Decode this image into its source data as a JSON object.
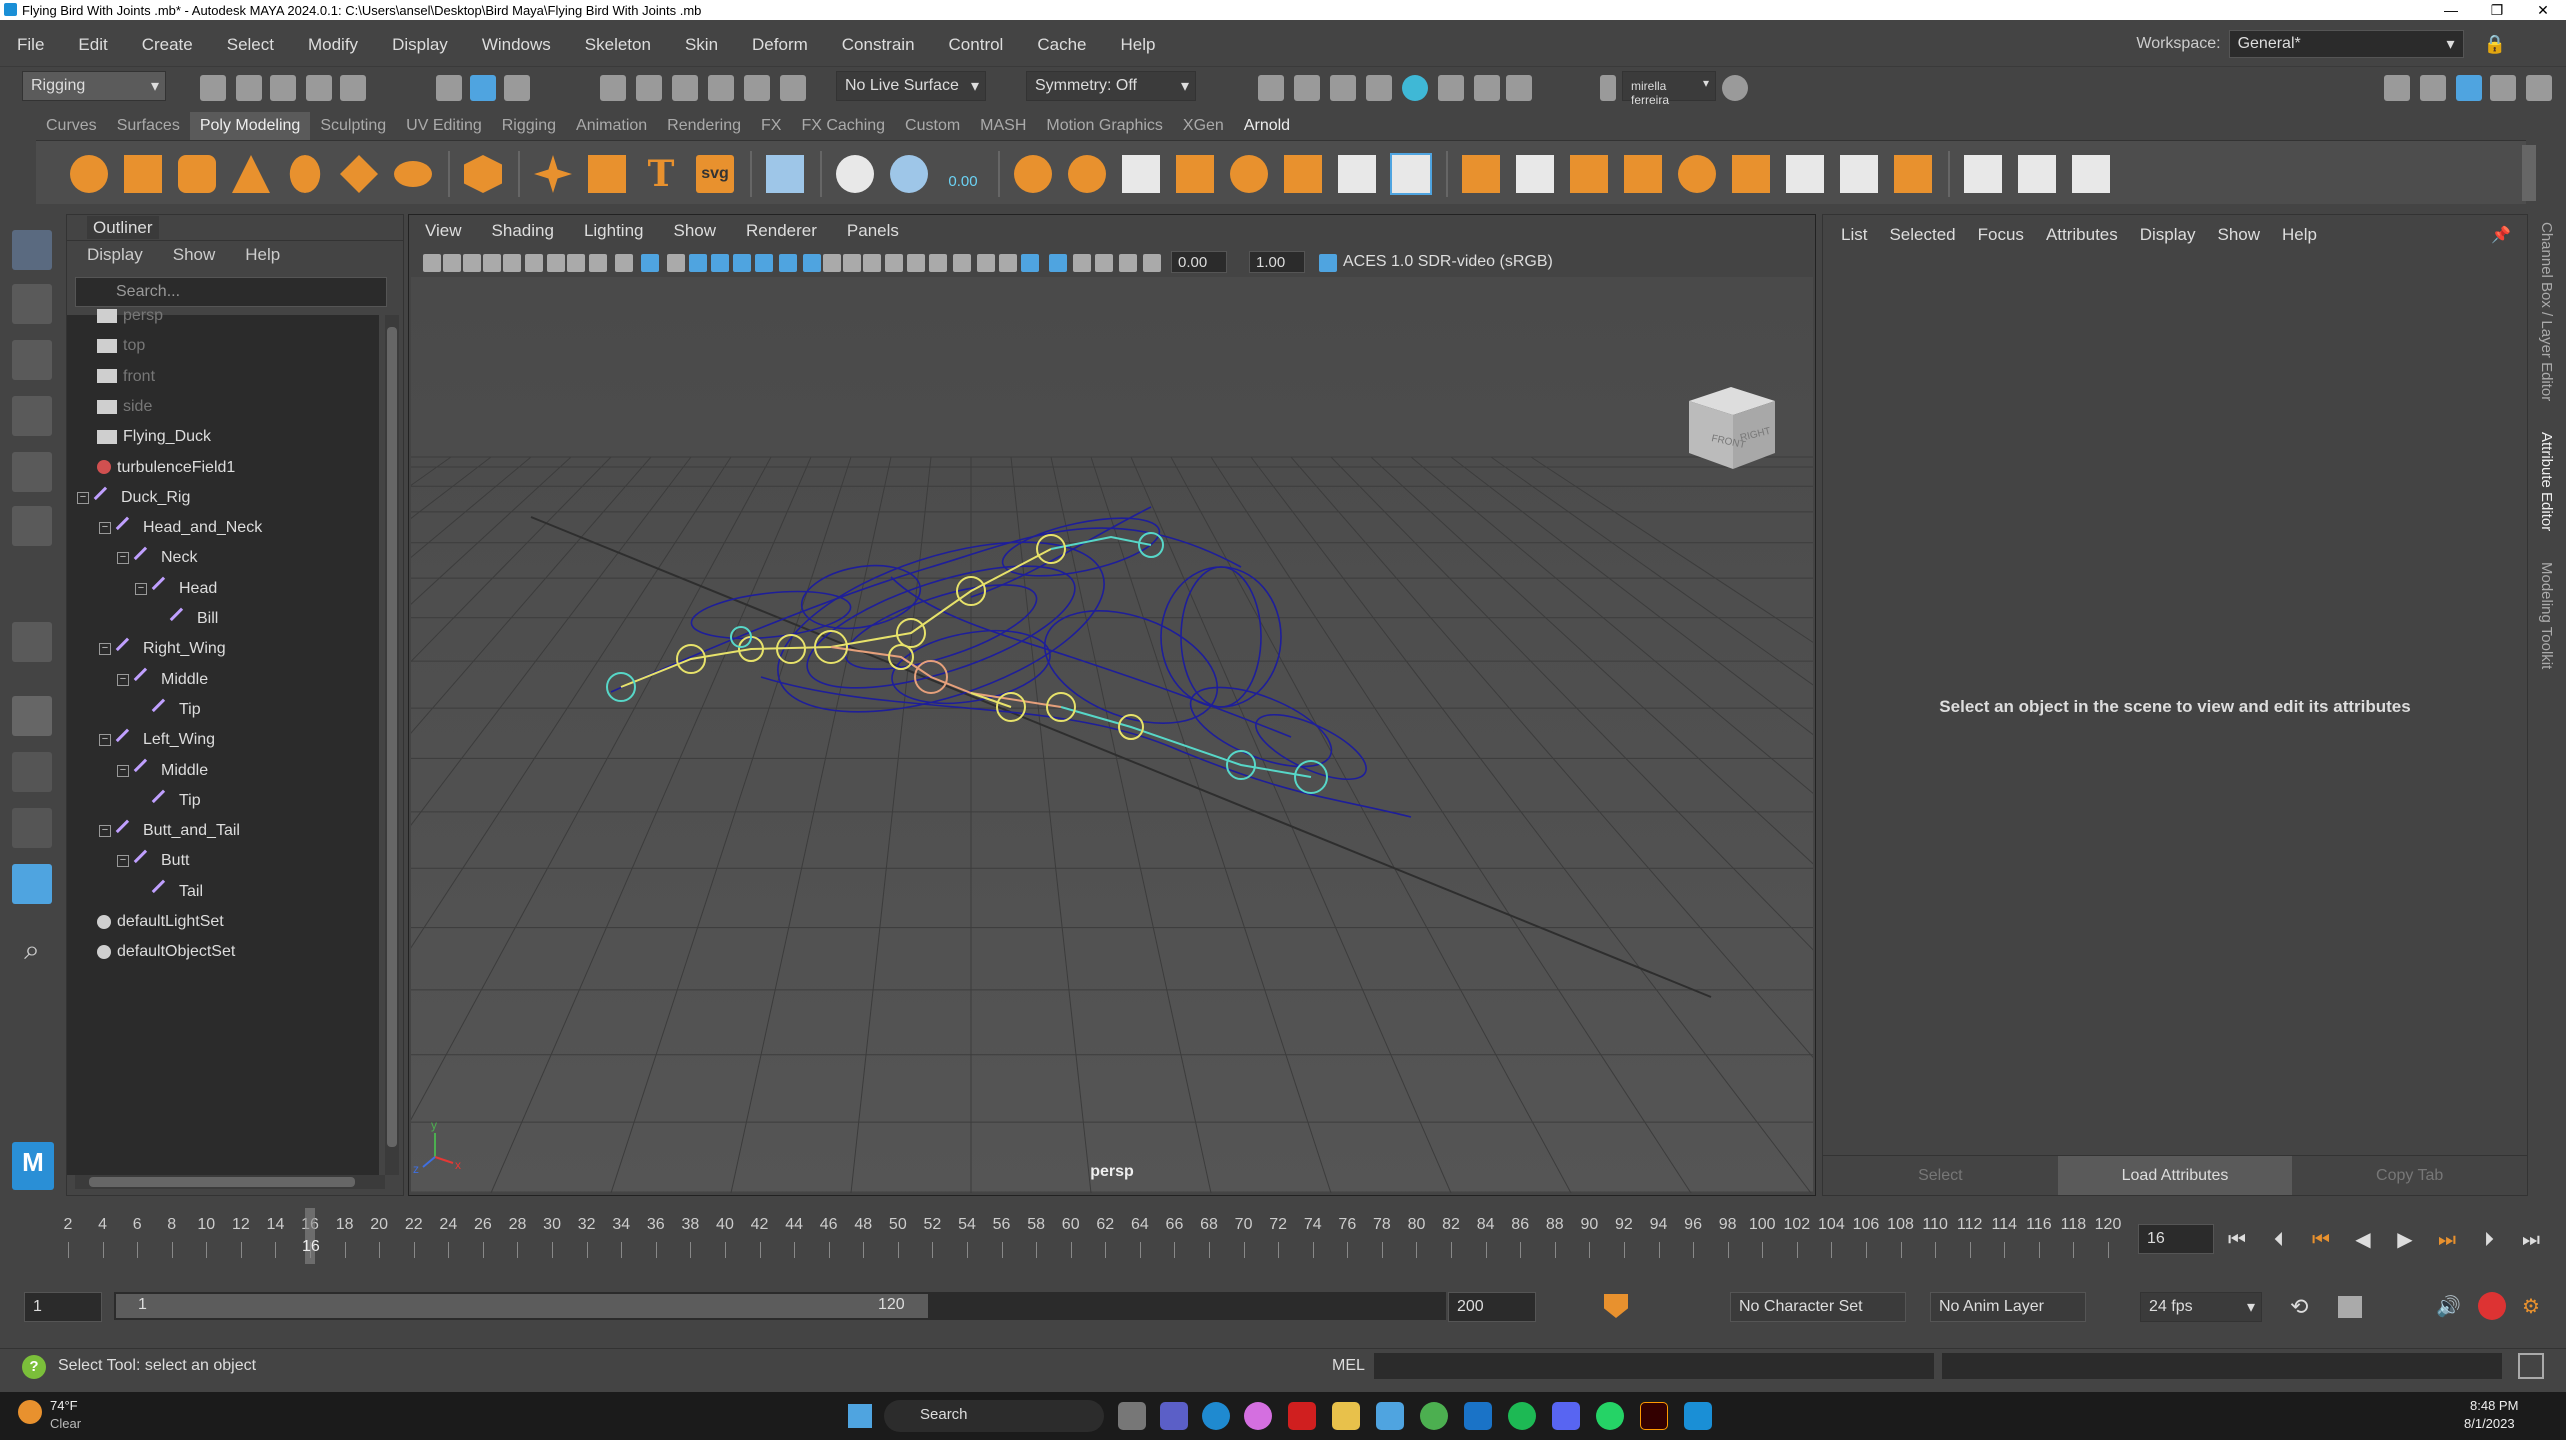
{
  "window": {
    "title": "Flying Bird With Joints .mb* - Autodesk MAYA 2024.0.1: C:\\Users\\ansel\\Desktop\\Bird Maya\\Flying Bird With Joints .mb",
    "controls": [
      "—",
      "❐",
      "✕"
    ]
  },
  "menubar": {
    "items": [
      "File",
      "Edit",
      "Create",
      "Select",
      "Modify",
      "Display",
      "Windows",
      "Skeleton",
      "Skin",
      "Deform",
      "Constrain",
      "Control",
      "Cache",
      "Help"
    ],
    "workspace_label": "Workspace:",
    "workspace_value": "General*"
  },
  "statusline": {
    "menuset": "Rigging",
    "live_surface": "No Live Surface",
    "symmetry": "Symmetry: Off",
    "user": "mirella ferreira"
  },
  "shelf": {
    "tabs": [
      "Curves",
      "Surfaces",
      "Poly Modeling",
      "Sculpting",
      "UV Editing",
      "Rigging",
      "Animation",
      "Rendering",
      "FX",
      "FX Caching",
      "Custom",
      "MASH",
      "Motion Graphics",
      "XGen",
      "Arnold"
    ],
    "active_tab": "Poly Modeling",
    "text_icon_label": "svg",
    "value_label": "0.00"
  },
  "outliner": {
    "title": "Outliner",
    "menu": [
      "Display",
      "Show",
      "Help"
    ],
    "search_placeholder": "Search...",
    "items": [
      {
        "label": "persp",
        "depth": 0,
        "kind": "camera",
        "dim": true
      },
      {
        "label": "top",
        "depth": 0,
        "kind": "camera",
        "dim": true
      },
      {
        "label": "front",
        "depth": 0,
        "kind": "camera",
        "dim": true
      },
      {
        "label": "side",
        "depth": 0,
        "kind": "camera",
        "dim": true
      },
      {
        "label": "Flying_Duck",
        "depth": 0,
        "kind": "mesh",
        "dim": false
      },
      {
        "label": "turbulenceField1",
        "depth": 0,
        "kind": "field",
        "dim": false
      },
      {
        "label": "Duck_Rig",
        "depth": 0,
        "kind": "joint",
        "dim": false,
        "expand": true
      },
      {
        "label": "Head_and_Neck",
        "depth": 1,
        "kind": "joint",
        "dim": false,
        "expand": true
      },
      {
        "label": "Neck",
        "depth": 2,
        "kind": "joint",
        "dim": false,
        "expand": true
      },
      {
        "label": "Head",
        "depth": 3,
        "kind": "joint",
        "dim": false,
        "expand": true
      },
      {
        "label": "Bill",
        "depth": 4,
        "kind": "joint",
        "dim": false
      },
      {
        "label": "Right_Wing",
        "depth": 1,
        "kind": "joint",
        "dim": false,
        "expand": true
      },
      {
        "label": "Middle",
        "depth": 2,
        "kind": "joint",
        "dim": false,
        "expand": true
      },
      {
        "label": "Tip",
        "depth": 3,
        "kind": "joint",
        "dim": false
      },
      {
        "label": "Left_Wing",
        "depth": 1,
        "kind": "joint",
        "dim": false,
        "expand": true
      },
      {
        "label": "Middle",
        "depth": 2,
        "kind": "joint",
        "dim": false,
        "expand": true
      },
      {
        "label": "Tip",
        "depth": 3,
        "kind": "joint",
        "dim": false
      },
      {
        "label": "Butt_and_Tail",
        "depth": 1,
        "kind": "joint",
        "dim": false,
        "expand": true
      },
      {
        "label": "Butt",
        "depth": 2,
        "kind": "joint",
        "dim": false,
        "expand": true
      },
      {
        "label": "Tail",
        "depth": 3,
        "kind": "joint",
        "dim": false
      },
      {
        "label": "defaultLightSet",
        "depth": 0,
        "kind": "set",
        "dim": false
      },
      {
        "label": "defaultObjectSet",
        "depth": 0,
        "kind": "set",
        "dim": false
      }
    ]
  },
  "viewport": {
    "menu": [
      "View",
      "Shading",
      "Lighting",
      "Show",
      "Renderer",
      "Panels"
    ],
    "exposure": "0.00",
    "gamma": "1.00",
    "colorspace": "ACES 1.0 SDR-video (sRGB)",
    "camera_label": "persp",
    "viewcube": {
      "front": "FRONT",
      "right": "RIGHT"
    },
    "axis": {
      "x": "x",
      "y": "y",
      "z": "z"
    }
  },
  "attribute_editor": {
    "menu": [
      "List",
      "Selected",
      "Focus",
      "Attributes",
      "Display",
      "Show",
      "Help"
    ],
    "message": "Select an object in the scene to view and edit its attributes",
    "buttons": [
      "Select",
      "Load Attributes",
      "Copy Tab"
    ],
    "side_tabs": [
      "Channel Box / Layer Editor",
      "Attribute Editor",
      "Modeling Toolkit"
    ]
  },
  "timeline": {
    "ticks": [
      "2",
      "4",
      "6",
      "8",
      "10",
      "12",
      "14",
      "16",
      "18",
      "20",
      "22",
      "24",
      "26",
      "28",
      "30",
      "32",
      "34",
      "36",
      "38",
      "40",
      "42",
      "44",
      "46",
      "48",
      "50",
      "52",
      "54",
      "56",
      "58",
      "60",
      "62",
      "64",
      "66",
      "68",
      "70",
      "72",
      "74",
      "76",
      "78",
      "80",
      "82",
      "84",
      "86",
      "88",
      "90",
      "92",
      "94",
      "96",
      "98",
      "100",
      "102",
      "104",
      "106",
      "108",
      "110",
      "112",
      "114",
      "116",
      "118",
      "120"
    ],
    "current_frame": "16",
    "current_frame_field": "16"
  },
  "range": {
    "start": "1",
    "range_start": "1",
    "range_end": "120",
    "end": "200",
    "character_set": "No Character Set",
    "anim_layer": "No Anim Layer",
    "fps": "24 fps"
  },
  "commandline": {
    "help": "Select Tool: select an object",
    "mel_label": "MEL"
  },
  "taskbar": {
    "weather_temp": "74°F",
    "weather_text": "Clear",
    "search": "Search",
    "time": "8:48 PM",
    "date": "8/1/2023"
  },
  "colors": {
    "maya_orange": "#e8912e",
    "select_blue": "#4fa4e0",
    "wire_blue": "#1e1e9a",
    "joint_yellow": "#e7e26a",
    "joint_cyan": "#57d7c8"
  }
}
